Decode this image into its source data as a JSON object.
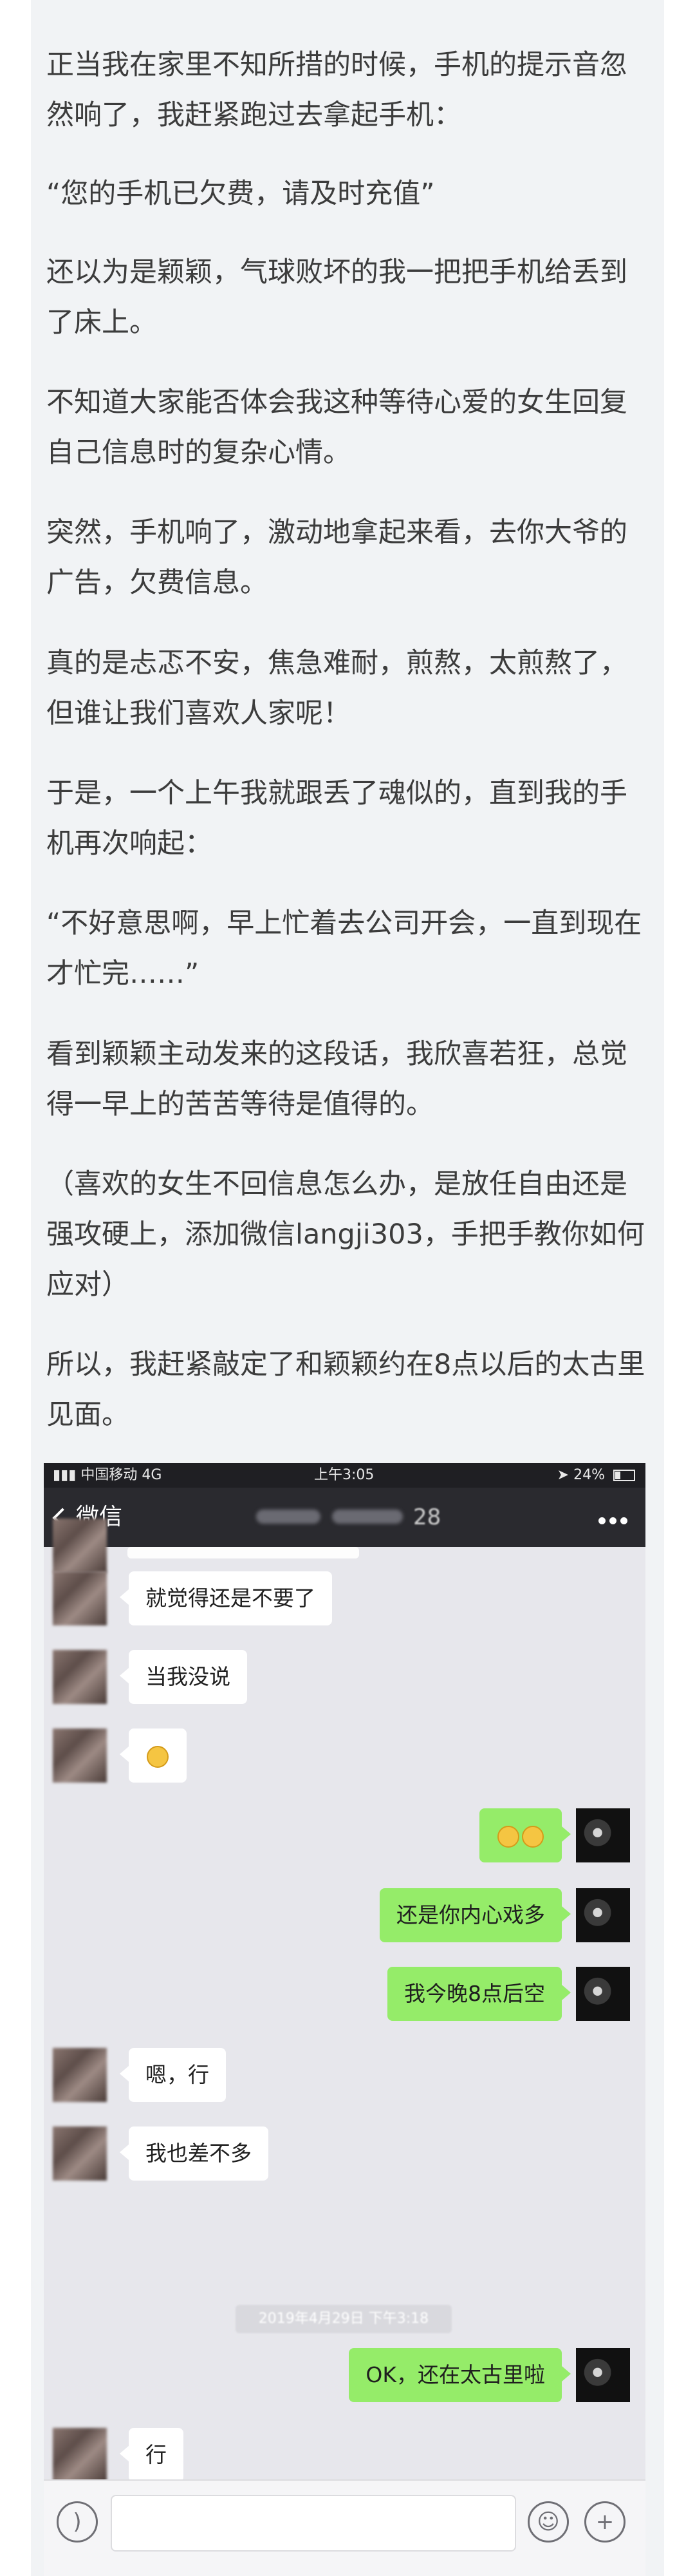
{
  "article": {
    "paragraphs": [
      "正当我在家里不知所措的时候，手机的提示音忽然响了，我赶紧跑过去拿起手机：",
      "“您的手机已欠费，请及时充值”",
      "还以为是颖颖，气球败坏的我一把把手机给丢到了床上。",
      "不知道大家能否体会我这种等待心爱的女生回复自己信息时的复杂心情。",
      "突然，手机响了，激动地拿起来看，去你大爷的广告，欠费信息。",
      "真的是忐忑不安，焦急难耐，煎熬，太煎熬了，但谁让我们喜欢人家呢！",
      "于是，一个上午我就跟丢了魂似的，直到我的手机再次响起：",
      "“不好意思啊，早上忙着去公司开会，一直到现在才忙完……”",
      "看到颖颖主动发来的这段话，我欣喜若狂，总觉得一早上的苦苦等待是值得的。",
      "（喜欢的女生不回信息怎么办，是放任自由还是强攻硬上，添加微信langji303，手把手教你如何应对）",
      "所以，我赶紧敲定了和颖颖约在8点以后的太古里见面。"
    ]
  },
  "screenshot": {
    "status": {
      "carrier": "中国移动",
      "network": "4G",
      "time": "上午3:05",
      "battery": "24%"
    },
    "nav": {
      "back_label": "微信",
      "title_suffix": "28"
    },
    "messages": [
      {
        "from": "them",
        "text": "就觉得还是不要了"
      },
      {
        "from": "them",
        "text": "当我没说"
      },
      {
        "from": "them",
        "text": "",
        "emoji": "laugh"
      },
      {
        "from": "me",
        "text": "",
        "emoji": "cry"
      },
      {
        "from": "me",
        "text": "还是你内心戏多"
      },
      {
        "from": "me",
        "text": "我今晚8点后空"
      },
      {
        "from": "them",
        "text": "嗯，行"
      },
      {
        "from": "them",
        "text": "我也差不多"
      },
      {
        "from": "me",
        "text": "OK，还在太古里啦"
      },
      {
        "from": "them",
        "text": "行"
      }
    ],
    "timestamp": "2019年4月29日 下午3:18",
    "colors": {
      "out_bubble": "#95ec69",
      "in_bubble": "#ffffff",
      "nav_bg": "#2a2a2f"
    }
  }
}
